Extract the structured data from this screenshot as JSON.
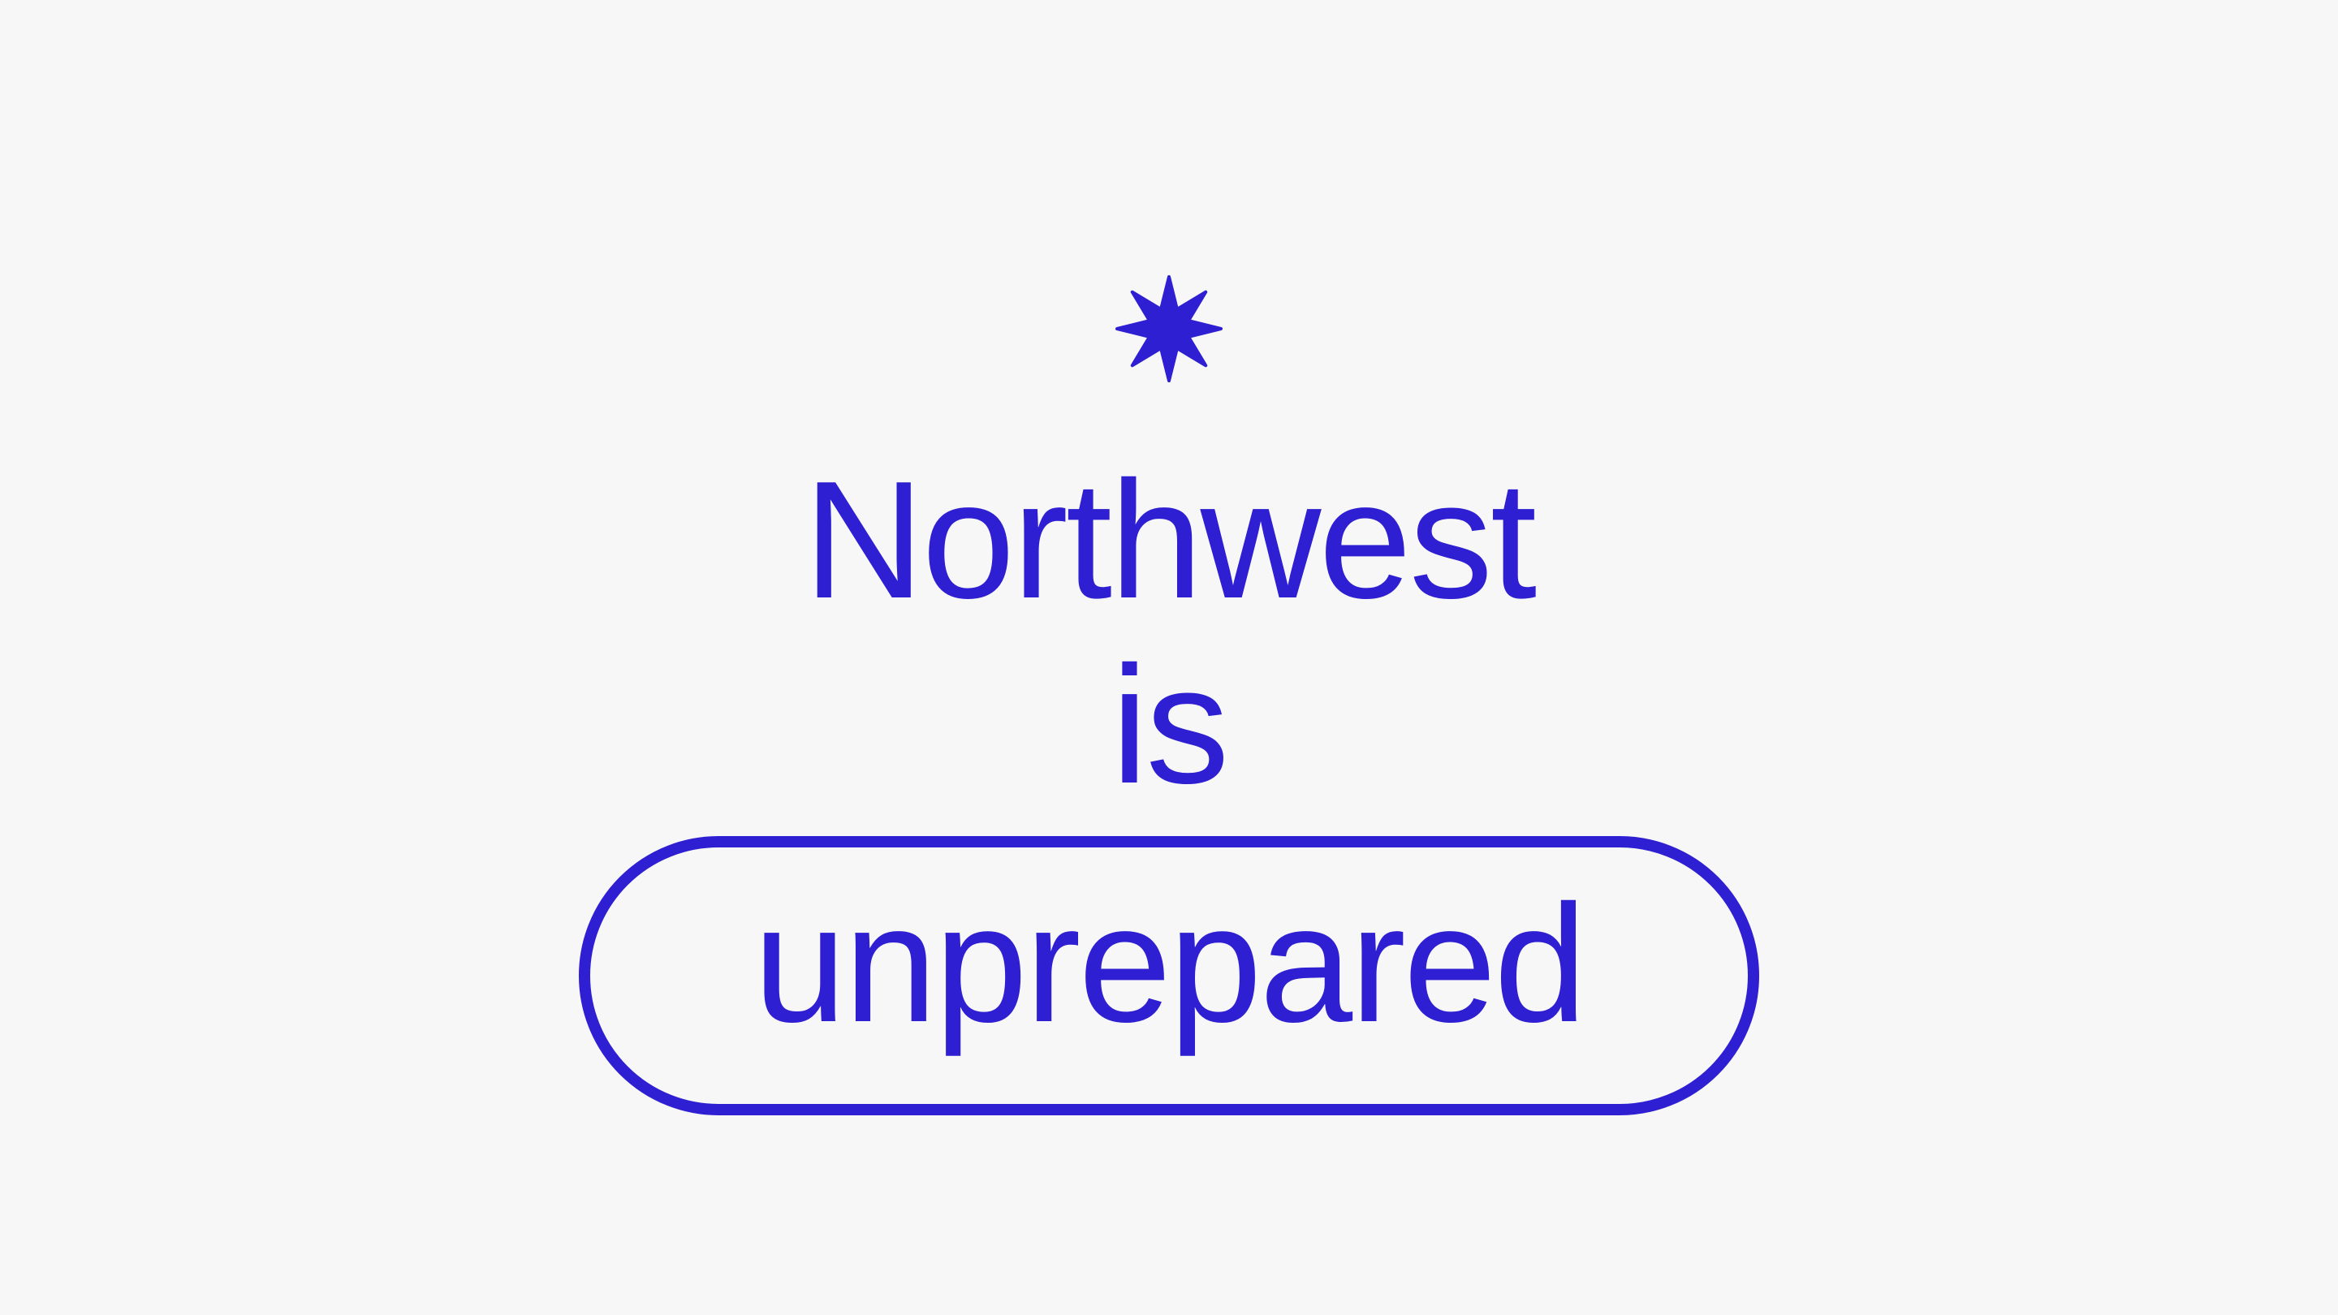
{
  "logo": {
    "icon": "eight-point-starburst-icon"
  },
  "headline": {
    "line1": "Northwest",
    "line2": "is",
    "highlighted_word": "unprepared"
  },
  "colors": {
    "accent": "#2e1fd2",
    "background": "#f7f7f7"
  }
}
